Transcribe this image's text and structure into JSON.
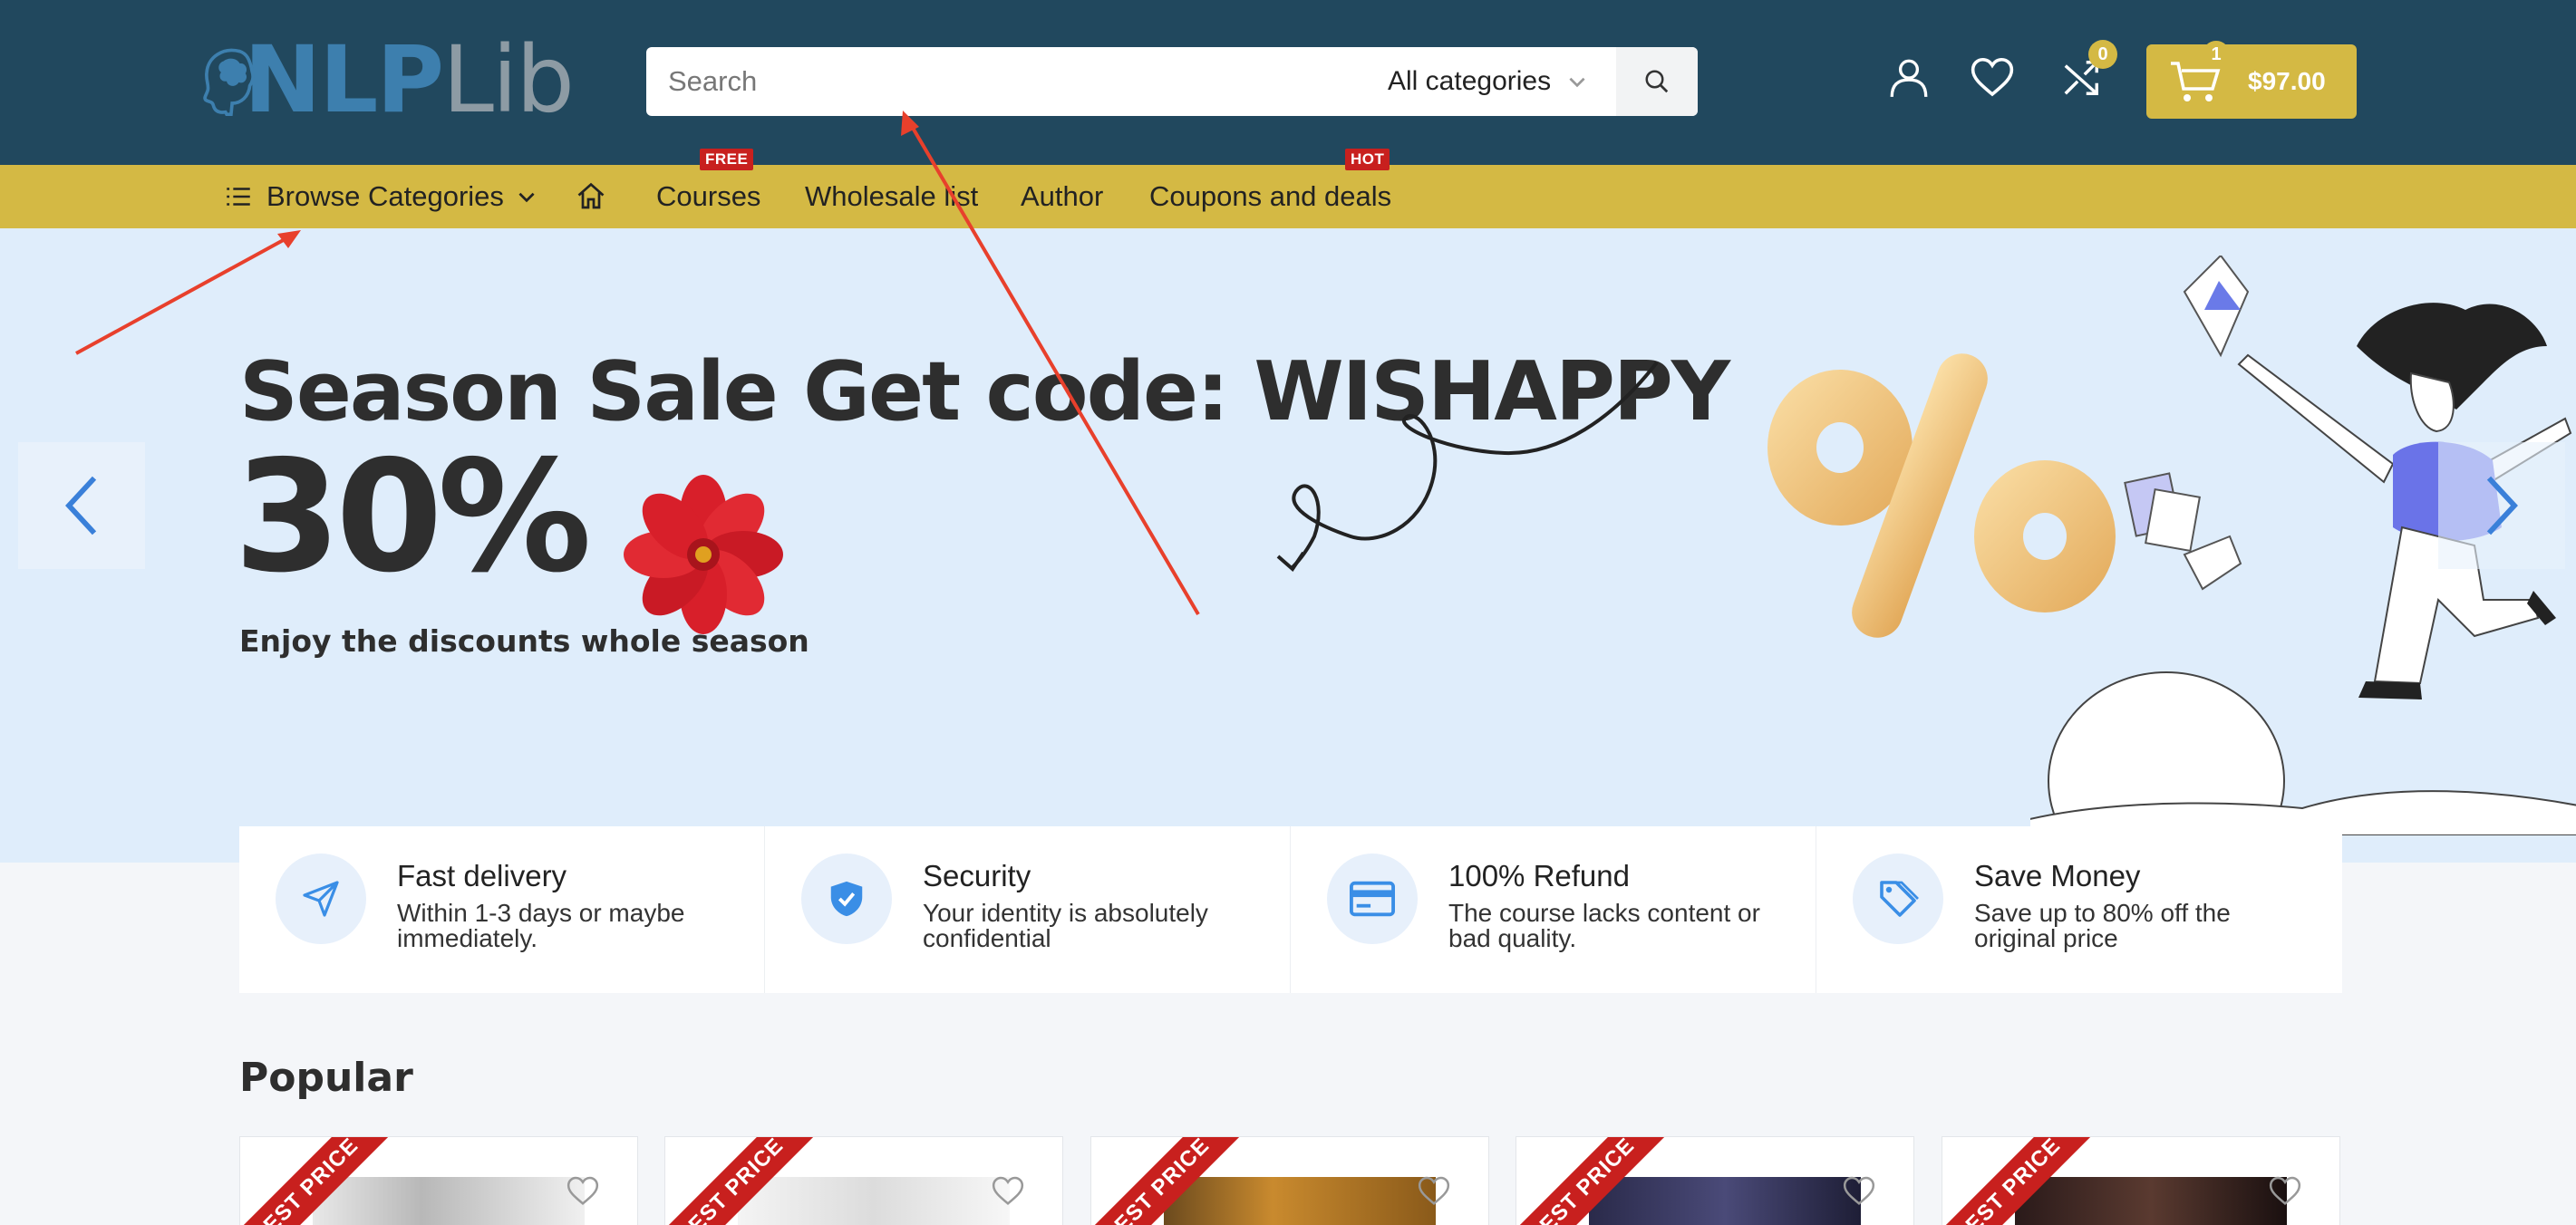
{
  "logo": {
    "part1": "NLP",
    "part2": "Lib"
  },
  "search": {
    "placeholder": "Search",
    "category": "All categories"
  },
  "header": {
    "compare_count": "0",
    "cart_count": "1",
    "cart_total": "$97.00"
  },
  "nav": {
    "browse": "Browse Categories",
    "items": [
      {
        "label": "Courses",
        "tag": "FREE"
      },
      {
        "label": "Wholesale list"
      },
      {
        "label": "Author"
      },
      {
        "label": "Coupons and deals",
        "tag": "HOT"
      }
    ]
  },
  "hero": {
    "title": "Season Sale Get code: WISHAPPY",
    "big": "30%",
    "subtitle": "Enjoy the discounts whole season"
  },
  "features": [
    {
      "title": "Fast delivery",
      "desc": "Within 1-3 days or maybe immediately.",
      "icon": "paper-plane-icon"
    },
    {
      "title": "Security",
      "desc": "Your identity is absolutely confidential",
      "icon": "shield-check-icon"
    },
    {
      "title": "100% Refund",
      "desc": "The course lacks content or bad quality.",
      "icon": "credit-card-icon"
    },
    {
      "title": "Save Money",
      "desc": "Save up to 80% off the original price",
      "icon": "tag-icon"
    }
  ],
  "popular": {
    "title": "Popular",
    "ribbon": "BEST PRICE"
  },
  "colors": {
    "header": "#21485e",
    "accent": "#d4b944",
    "hero_bg": "#dfedfb",
    "hot_tag": "#c8201e",
    "icon_blue": "#3a8ee6",
    "annotation": "#e8402c"
  }
}
